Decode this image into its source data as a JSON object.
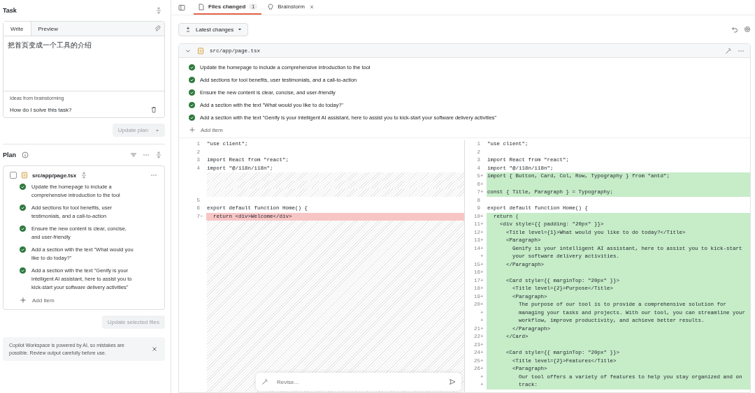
{
  "task": {
    "title": "Task",
    "tabs": [
      {
        "label": "Write",
        "selected": true
      },
      {
        "label": "Preview",
        "selected": false
      }
    ],
    "text": "把首页变成一个工具的介绍",
    "ideas_label": "Ideas from brainstorming",
    "idea": "How do I solve this task?",
    "update_button": "Update plan"
  },
  "plan": {
    "title": "Plan",
    "file": {
      "name": "src/app/page.tsx",
      "checked": false
    },
    "items": [
      {
        "text": "Update the homepage to include a comprehensive introduction to the tool",
        "checked": true
      },
      {
        "text": "Add sections for tool benefits, user testimonials, and a call-to-action",
        "checked": true
      },
      {
        "text": "Ensure the new content is clear, concise, and user-friendly",
        "checked": true
      },
      {
        "text": "Add a section with the text \"What would you like to do today?\"",
        "checked": true
      },
      {
        "text": "Add a section with the text \"Genify is your intelligent AI assistant, here to assist you to kick-start your software delivery activities\"",
        "checked": true
      }
    ],
    "add_item": "Add item",
    "update_button": "Update selected files"
  },
  "notice": "Copilot Workspace is powered by AI, so mistakes are possible. Review output carefully before use.",
  "tabs": [
    {
      "label": "Files changed",
      "badge": "1",
      "selected": true
    },
    {
      "label": "Brainstorm",
      "selected": false
    }
  ],
  "toolbar": {
    "dropdown": "Latest changes"
  },
  "file": {
    "path": "src/app/page.tsx",
    "checklist": [
      {
        "text": "Update the homepage to include a comprehensive introduction to the tool",
        "checked": true
      },
      {
        "text": "Add sections for tool benefits, user testimonials, and a call-to-action",
        "checked": true
      },
      {
        "text": "Ensure the new content is clear, concise, and user-friendly",
        "checked": true
      },
      {
        "text": "Add a section with the text \"What would you like to do today?\"",
        "checked": true
      },
      {
        "text": "Add a section with the text \"Genify is your intelligent AI assistant, here to assist you to kick-start your software delivery activities\"",
        "checked": true
      }
    ],
    "add_item": "Add item",
    "left_lines": [
      {
        "kind": "context",
        "number": "1",
        "code": "\"use client\";"
      },
      {
        "kind": "context",
        "number": "2"
      },
      {
        "kind": "context",
        "number": "3",
        "code": "import React from \"react\";"
      },
      {
        "kind": "context",
        "number": "4",
        "code": "import \"@/i18n/i18n\";"
      },
      {
        "kind": "filler"
      },
      {
        "kind": "filler"
      },
      {
        "kind": "filler"
      },
      {
        "kind": "context",
        "number": "5"
      },
      {
        "kind": "context",
        "number": "6",
        "code": "export default function Home() {"
      },
      {
        "kind": "removed",
        "number": "7",
        "marker": "−",
        "code": "  return <div>Welcome</div>"
      }
    ],
    "right_lines": [
      {
        "kind": "context",
        "number": "1",
        "code": "\"use client\";"
      },
      {
        "kind": "context",
        "number": "2"
      },
      {
        "kind": "context",
        "number": "3",
        "code": "import React from \"react\";"
      },
      {
        "kind": "context",
        "number": "4",
        "code": "import \"@/i18n/i18n\";"
      },
      {
        "kind": "added",
        "number": "5",
        "marker": "+",
        "code": "import { Button, Card, Col, Row, Typography } from \"antd\";"
      },
      {
        "kind": "added",
        "number": "6",
        "marker": "+"
      },
      {
        "kind": "added",
        "number": "7",
        "marker": "+",
        "code": "const { Title, Paragraph } = Typography;"
      },
      {
        "kind": "context",
        "number": "8"
      },
      {
        "kind": "context",
        "number": "9",
        "code": "export default function Home() {"
      },
      {
        "kind": "added",
        "number": "10",
        "marker": "+",
        "code": "  return ("
      },
      {
        "kind": "added",
        "number": "11",
        "marker": "+",
        "code": "    <div style={{ padding: \"20px\" }}>"
      },
      {
        "kind": "added",
        "number": "12",
        "marker": "+",
        "code": "      <Title level={1}>What would you like to do today?</Title>"
      },
      {
        "kind": "added",
        "number": "13",
        "marker": "+",
        "code": "      <Paragraph>"
      },
      {
        "kind": "added",
        "number": "14",
        "marker": "+",
        "code": "        Genify is your intelligent AI assistant, here to assist you to kick-start"
      },
      {
        "kind": "added",
        "marker": "+",
        "code": "        your software delivery activities."
      },
      {
        "kind": "added",
        "number": "15",
        "marker": "+",
        "code": "      </Paragraph>"
      },
      {
        "kind": "added",
        "number": "16",
        "marker": "+"
      },
      {
        "kind": "added",
        "number": "17",
        "marker": "+",
        "code": "      <Card style={{ marginTop: \"20px\" }}>"
      },
      {
        "kind": "added",
        "number": "18",
        "marker": "+",
        "code": "        <Title level={2}>Purpose</Title>"
      },
      {
        "kind": "added",
        "number": "19",
        "marker": "+",
        "code": "        <Paragraph>"
      },
      {
        "kind": "added",
        "number": "20",
        "marker": "+",
        "code": "          The purpose of our tool is to provide a comprehensive solution for"
      },
      {
        "kind": "added",
        "marker": "+",
        "code": "          managing your tasks and projects. With our tool, you can streamline your"
      },
      {
        "kind": "added",
        "marker": "+",
        "code": "          workflow, improve productivity, and achieve better results."
      },
      {
        "kind": "added",
        "number": "21",
        "marker": "+",
        "code": "        </Paragraph>"
      },
      {
        "kind": "added",
        "number": "22",
        "marker": "+",
        "code": "      </Card>"
      },
      {
        "kind": "added",
        "number": "23",
        "marker": "+"
      },
      {
        "kind": "added",
        "number": "24",
        "marker": "+",
        "code": "      <Card style={{ marginTop: \"20px\" }}>"
      },
      {
        "kind": "added",
        "number": "25",
        "marker": "+",
        "code": "        <Title level={2}>Features</Title>"
      },
      {
        "kind": "added",
        "number": "26",
        "marker": "+",
        "code": "        <Paragraph>"
      },
      {
        "kind": "added",
        "marker": "+",
        "code": "          Our tool offers a variety of features to help you stay organized and on"
      },
      {
        "kind": "added",
        "marker": "+",
        "code": "          track:"
      }
    ]
  },
  "revise": {
    "placeholder": "Revise..."
  }
}
